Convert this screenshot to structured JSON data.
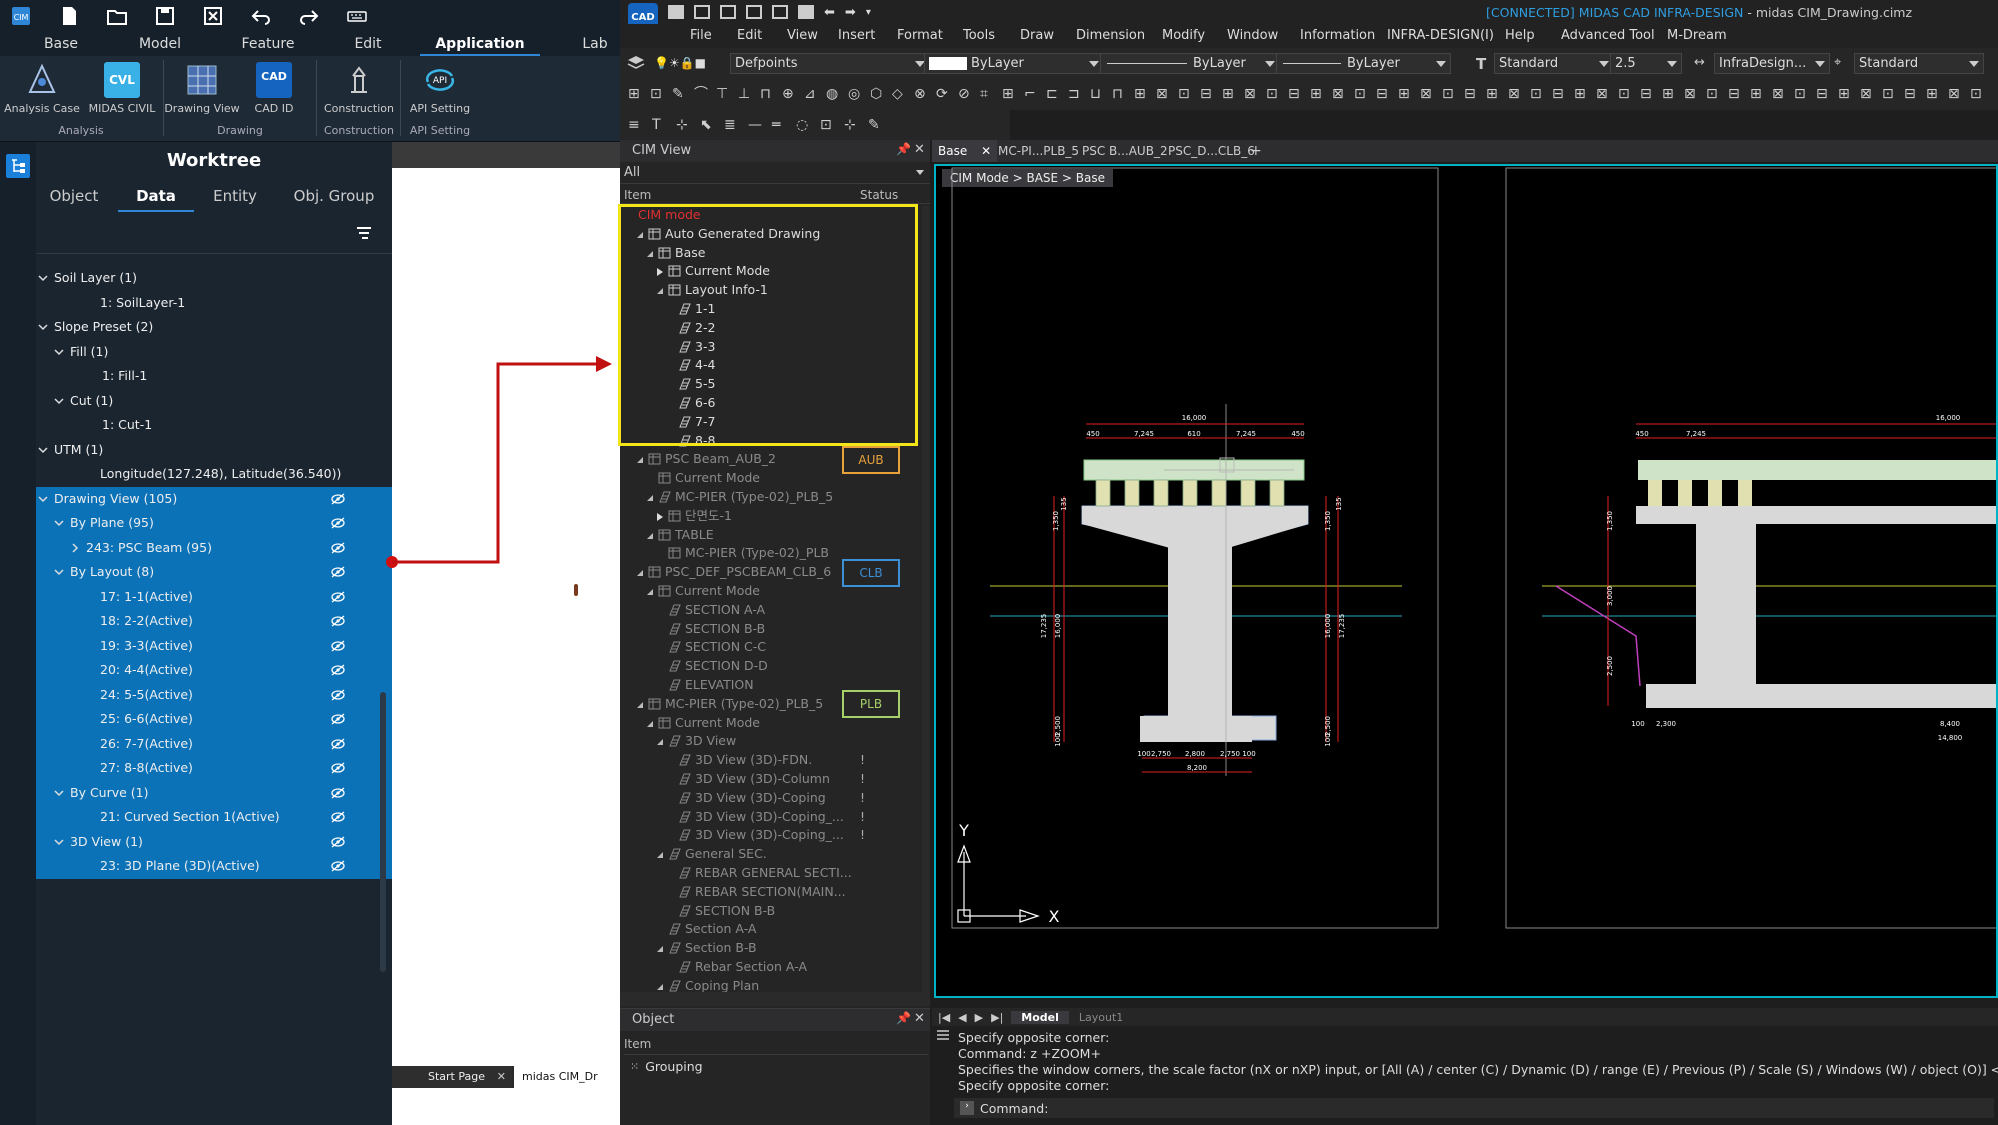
{
  "cim_app": {
    "quick_icons": [
      "cim-logo-icon",
      "new-file-icon",
      "open-folder-icon",
      "save-icon",
      "close-file-icon",
      "undo-icon",
      "redo-icon",
      "keyboard-icon"
    ],
    "ribbon_tabs": [
      "Base",
      "Model",
      "Feature",
      "Edit",
      "Application",
      "Lab"
    ],
    "active_tab": "Application",
    "ribbon_buttons": [
      {
        "label": "Analysis Case",
        "icon": "analysis-case-icon"
      },
      {
        "label": "MIDAS CIVIL",
        "icon": "cvl-icon"
      },
      {
        "label": "Drawing View",
        "icon": "drawing-view-icon"
      },
      {
        "label": "CAD ID",
        "icon": "cad-id-icon"
      },
      {
        "label": "Construction",
        "icon": "construction-icon"
      },
      {
        "label": "API Setting",
        "icon": "api-icon"
      }
    ],
    "cvl_text": "CVL",
    "cad_text": "CAD",
    "api_text": "API",
    "ribbon_groups": [
      "Analysis",
      "Drawing",
      "Construction",
      "API Setting"
    ],
    "worktree": {
      "title": "Worktree",
      "tabs": [
        "Object",
        "Data",
        "Entity",
        "Obj. Group"
      ],
      "active_tab": "Data",
      "rows": [
        {
          "label": "Soil Layer (1)",
          "level": 0,
          "expand": "down",
          "sel": false
        },
        {
          "label": "1: SoilLayer-1",
          "level": 2,
          "expand": "none",
          "sel": false
        },
        {
          "label": "Slope Preset (2)",
          "level": 0,
          "expand": "down",
          "sel": false
        },
        {
          "label": "Fill (1)",
          "level": 1,
          "expand": "down",
          "sel": false
        },
        {
          "label": "1: Fill-1",
          "level": 2.5,
          "expand": "none",
          "sel": false
        },
        {
          "label": "Cut (1)",
          "level": 1,
          "expand": "down",
          "sel": false
        },
        {
          "label": "1: Cut-1",
          "level": 2.5,
          "expand": "none",
          "sel": false
        },
        {
          "label": "UTM (1)",
          "level": 0,
          "expand": "down",
          "sel": false
        },
        {
          "label": "Longitude(127.248), Latitude(36.540))",
          "level": 2,
          "expand": "none",
          "sel": false
        },
        {
          "label": "Drawing View (105)",
          "level": 0,
          "expand": "down",
          "sel": true
        },
        {
          "label": "By Plane (95)",
          "level": 1,
          "expand": "down",
          "sel": true
        },
        {
          "label": "243: PSC Beam (95)",
          "level": 2,
          "expand": "right",
          "sel": true
        },
        {
          "label": "By Layout (8)",
          "level": 1,
          "expand": "down",
          "sel": true
        },
        {
          "label": "17: 1-1(Active)",
          "level": 2,
          "expand": "none",
          "sel": true
        },
        {
          "label": "18: 2-2(Active)",
          "level": 2,
          "expand": "none",
          "sel": true
        },
        {
          "label": "19: 3-3(Active)",
          "level": 2,
          "expand": "none",
          "sel": true
        },
        {
          "label": "20: 4-4(Active)",
          "level": 2,
          "expand": "none",
          "sel": true
        },
        {
          "label": "24: 5-5(Active)",
          "level": 2,
          "expand": "none",
          "sel": true
        },
        {
          "label": "25: 6-6(Active)",
          "level": 2,
          "expand": "none",
          "sel": true
        },
        {
          "label": "26: 7-7(Active)",
          "level": 2,
          "expand": "none",
          "sel": true
        },
        {
          "label": "27: 8-8(Active)",
          "level": 2,
          "expand": "none",
          "sel": true
        },
        {
          "label": "By Curve (1)",
          "level": 1,
          "expand": "down",
          "sel": true
        },
        {
          "label": "21: Curved Section 1(Active)",
          "level": 2,
          "expand": "none",
          "sel": true
        },
        {
          "label": "3D View (1)",
          "level": 1,
          "expand": "down",
          "sel": true
        },
        {
          "label": "23: 3D Plane (3D)(Active)",
          "level": 2,
          "expand": "none",
          "sel": true
        }
      ]
    },
    "bottom_tabs": {
      "start": "Start Page",
      "doc": "midas CIM_Dr"
    }
  },
  "cad_app": {
    "logo": "CAD",
    "title_connected": "[CONNECTED] MIDAS CAD INFRA-DESIGN",
    "title_file": " - midas CIM_Drawing.cimz",
    "menu": [
      "File",
      "Edit",
      "View",
      "Insert",
      "Format",
      "Tools",
      "Draw",
      "Dimension",
      "Modify",
      "Window",
      "Information",
      "INFRA-DESIGN(I)",
      "Help",
      "Advanced Tool",
      "M-Dream"
    ],
    "props": {
      "layer": "Defpoints",
      "color": "ByLayer",
      "linetype": "ByLayer",
      "lineweight": "ByLayer",
      "text_style": "Standard",
      "text_height": "2.5",
      "dim_style": "InfraDesign...",
      "table_style": "Standard"
    },
    "cim_view": {
      "title": "CIM View",
      "filter": "All",
      "col_item": "Item",
      "col_status": "Status",
      "rows": [
        {
          "label": "CIM mode",
          "indent": 0,
          "tri": "none",
          "icon": "none",
          "style": "red"
        },
        {
          "label": "Auto Generated Drawing",
          "indent": 1,
          "tri": "open",
          "icon": "grid",
          "style": ""
        },
        {
          "label": "Base",
          "indent": 2,
          "tri": "open",
          "icon": "grid",
          "style": ""
        },
        {
          "label": "Current Mode",
          "indent": 3,
          "tri": "closed",
          "icon": "grid",
          "style": ""
        },
        {
          "label": "Layout Info-1",
          "indent": 3,
          "tri": "open",
          "icon": "grid",
          "style": ""
        },
        {
          "label": "1-1",
          "indent": 4,
          "tri": "none",
          "icon": "sheet",
          "style": ""
        },
        {
          "label": "2-2",
          "indent": 4,
          "tri": "none",
          "icon": "sheet",
          "style": ""
        },
        {
          "label": "3-3",
          "indent": 4,
          "tri": "none",
          "icon": "sheet",
          "style": ""
        },
        {
          "label": "4-4",
          "indent": 4,
          "tri": "none",
          "icon": "sheet",
          "style": ""
        },
        {
          "label": "5-5",
          "indent": 4,
          "tri": "none",
          "icon": "sheet",
          "style": ""
        },
        {
          "label": "6-6",
          "indent": 4,
          "tri": "none",
          "icon": "sheet",
          "style": ""
        },
        {
          "label": "7-7",
          "indent": 4,
          "tri": "none",
          "icon": "sheet",
          "style": ""
        },
        {
          "label": "8-8",
          "indent": 4,
          "tri": "none",
          "icon": "sheet",
          "style": ""
        },
        {
          "label": "PSC Beam_AUB_2",
          "indent": 1,
          "tri": "open",
          "icon": "grid",
          "style": "dim"
        },
        {
          "label": "Current Mode",
          "indent": 2,
          "tri": "none",
          "icon": "grid",
          "style": "dim"
        },
        {
          "label": "MC-PIER (Type-02)_PLB_5",
          "indent": 2,
          "tri": "open",
          "icon": "sheet",
          "style": "dim"
        },
        {
          "label": "단면도-1",
          "indent": 3,
          "tri": "closed",
          "icon": "grid",
          "style": "dim"
        },
        {
          "label": "TABLE",
          "indent": 2,
          "tri": "open",
          "icon": "grid",
          "style": "dim"
        },
        {
          "label": "MC-PIER (Type-02)_PLB",
          "indent": 3,
          "tri": "none",
          "icon": "grid",
          "style": "dim"
        },
        {
          "label": "PSC_DEF_PSCBEAM_CLB_6",
          "indent": 1,
          "tri": "open",
          "icon": "grid",
          "style": "dim"
        },
        {
          "label": "Current Mode",
          "indent": 2,
          "tri": "open",
          "icon": "grid",
          "style": "dim"
        },
        {
          "label": "SECTION A-A",
          "indent": 3,
          "tri": "none",
          "icon": "sheet",
          "style": "dim"
        },
        {
          "label": "SECTION B-B",
          "indent": 3,
          "tri": "none",
          "icon": "sheet",
          "style": "dim"
        },
        {
          "label": "SECTION C-C",
          "indent": 3,
          "tri": "none",
          "icon": "sheet",
          "style": "dim"
        },
        {
          "label": "SECTION D-D",
          "indent": 3,
          "tri": "none",
          "icon": "sheet",
          "style": "dim"
        },
        {
          "label": "ELEVATION",
          "indent": 3,
          "tri": "none",
          "icon": "sheet",
          "style": "dim"
        },
        {
          "label": "MC-PIER (Type-02)_PLB_5",
          "indent": 1,
          "tri": "open",
          "icon": "grid",
          "style": "dim"
        },
        {
          "label": "Current Mode",
          "indent": 2,
          "tri": "open",
          "icon": "grid",
          "style": "dim"
        },
        {
          "label": "3D View",
          "indent": 3,
          "tri": "open",
          "icon": "sheet",
          "style": "dim"
        },
        {
          "label": "3D View (3D)-FDN.",
          "indent": 4,
          "tri": "none",
          "icon": "sheet",
          "style": "dim",
          "status": "!"
        },
        {
          "label": "3D View (3D)-Column",
          "indent": 4,
          "tri": "none",
          "icon": "sheet",
          "style": "dim",
          "status": "!"
        },
        {
          "label": "3D View (3D)-Coping",
          "indent": 4,
          "tri": "none",
          "icon": "sheet",
          "style": "dim",
          "status": "!"
        },
        {
          "label": "3D View (3D)-Coping_...",
          "indent": 4,
          "tri": "none",
          "icon": "sheet",
          "style": "dim",
          "status": "!"
        },
        {
          "label": "3D View (3D)-Coping_...",
          "indent": 4,
          "tri": "none",
          "icon": "sheet",
          "style": "dim",
          "status": "!"
        },
        {
          "label": "General SEC.",
          "indent": 3,
          "tri": "open",
          "icon": "sheet",
          "style": "dim"
        },
        {
          "label": "REBAR GENERAL SECTI...",
          "indent": 4,
          "tri": "none",
          "icon": "sheet",
          "style": "dim"
        },
        {
          "label": "REBAR SECTION(MAIN...",
          "indent": 4,
          "tri": "none",
          "icon": "sheet",
          "style": "dim"
        },
        {
          "label": "SECTION B-B",
          "indent": 4,
          "tri": "none",
          "icon": "sheet",
          "style": "dim"
        },
        {
          "label": "Section A-A",
          "indent": 3,
          "tri": "none",
          "icon": "sheet",
          "style": "dim"
        },
        {
          "label": "Section B-B",
          "indent": 3,
          "tri": "open",
          "icon": "sheet",
          "style": "dim"
        },
        {
          "label": "Rebar Section A-A",
          "indent": 4,
          "tri": "none",
          "icon": "sheet",
          "style": "dim"
        },
        {
          "label": "Coping Plan",
          "indent": 3,
          "tri": "open",
          "icon": "sheet",
          "style": "dim"
        }
      ],
      "tags": {
        "aub": "AUB",
        "clb": "CLB",
        "plb": "PLB"
      },
      "tag_colors": {
        "yellow": "#f2e51a",
        "aub": "#e8a23a",
        "clb": "#3d8fd6",
        "plb": "#a8d06a"
      }
    },
    "object_panel": {
      "title": "Object",
      "col_item": "Item",
      "grouping": "Grouping"
    },
    "doc_tabs": [
      "Base",
      "MC-PI...PLB_5",
      "PSC B...AUB_2",
      "PSC_D...CLB_6"
    ],
    "breadcrumb": "CIM Mode > BASE > Base",
    "dims": {
      "top_total": "16,000",
      "top_parts": [
        "450",
        "7,245",
        "610",
        "7,245",
        "450"
      ],
      "bottom_total": "8,200",
      "bottom_parts": [
        "100",
        "2,750",
        "2,800",
        "2,750",
        "100"
      ],
      "left_v": [
        "1,350",
        "135",
        "17,235",
        "16,000",
        "2,500",
        "100"
      ],
      "right_v": [
        "1,350",
        "135",
        "17,235",
        "16,000",
        "2,500",
        "100"
      ],
      "second_top_total": "16,000",
      "second_top_parts": [
        "450",
        "7,245"
      ],
      "second_left": [
        "1,350",
        "3,000",
        "2,500"
      ],
      "second_bottom": [
        "100",
        "2,300",
        "8,400",
        "14,800"
      ]
    },
    "axis": {
      "x": "X",
      "y": "Y"
    },
    "layout_tabs": {
      "model": "Model",
      "layout": "Layout1"
    },
    "command": [
      "Specify opposite corner:",
      "Command:  z +ZOOM+",
      "Specifies the window corners, the scale factor (nX or nXP) input, or [All (A) / center (C) / Dynamic (D) / range (E) / Previous (P) / Scale (S) / Windows (W) / object (O)] <re",
      "Specify opposite corner:"
    ],
    "command_prompt": "Command:"
  }
}
